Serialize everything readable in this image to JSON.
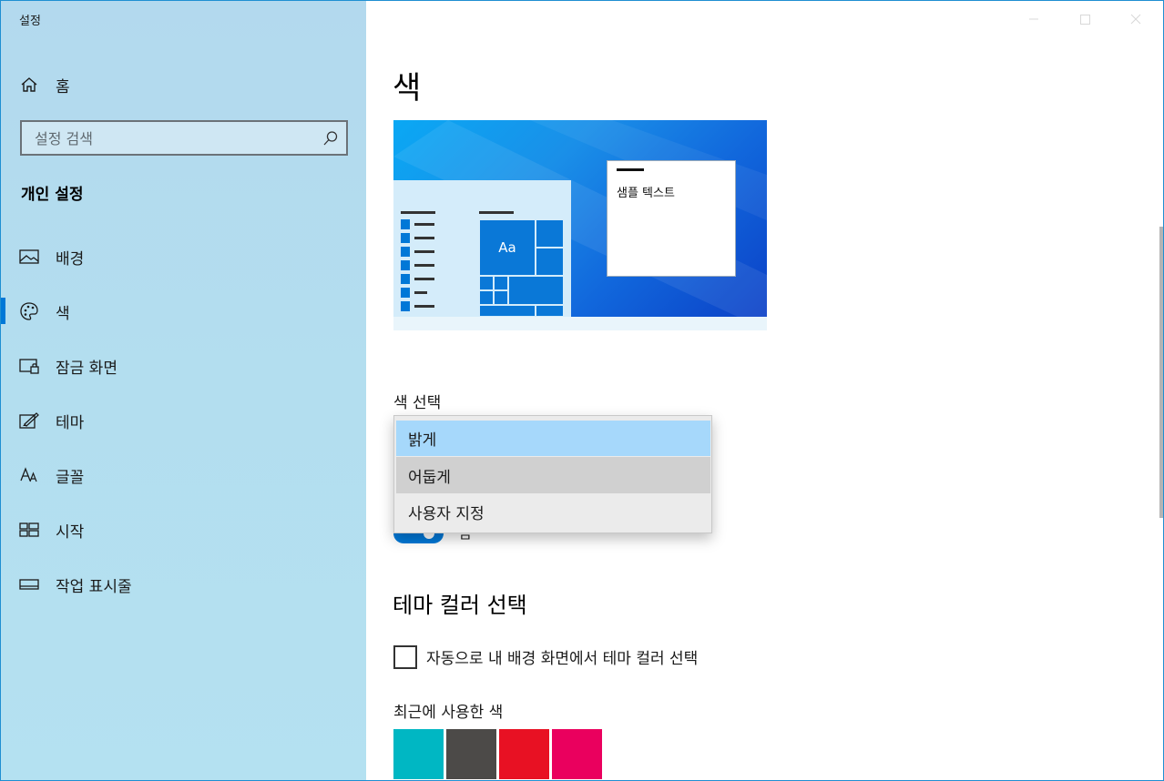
{
  "app": {
    "title": "설정"
  },
  "sidebar": {
    "home_label": "홈",
    "search": {
      "placeholder": "설정 검색"
    },
    "section_title": "개인 설정",
    "items": [
      {
        "label": "배경",
        "icon": "picture-icon"
      },
      {
        "label": "색",
        "icon": "palette-icon",
        "active": true
      },
      {
        "label": "잠금 화면",
        "icon": "lock-screen-icon"
      },
      {
        "label": "테마",
        "icon": "theme-icon"
      },
      {
        "label": "글꼴",
        "icon": "font-icon"
      },
      {
        "label": "시작",
        "icon": "start-icon"
      },
      {
        "label": "작업 표시줄",
        "icon": "taskbar-icon"
      }
    ]
  },
  "main": {
    "title": "색",
    "preview": {
      "sample_text": "샘플 텍스트",
      "tile_text": "Aa"
    },
    "choose_color": {
      "label": "색 선택",
      "options": [
        "밝게",
        "어둡게",
        "사용자 지정"
      ],
      "selected": "밝게"
    },
    "toggle_partial_text": "끔",
    "accent": {
      "heading": "테마 컬러 선택",
      "auto_checkbox_label": "자동으로 내 배경 화면에서 테마 컬러 선택",
      "auto_checked": false,
      "recent_label": "최근에 사용한 색",
      "recent_colors": [
        "#00b7c3",
        "#4c4a48",
        "#e81123",
        "#ea005e"
      ]
    }
  },
  "colors": {
    "accent": "#0078d7",
    "selection": "#a6d8fb"
  }
}
